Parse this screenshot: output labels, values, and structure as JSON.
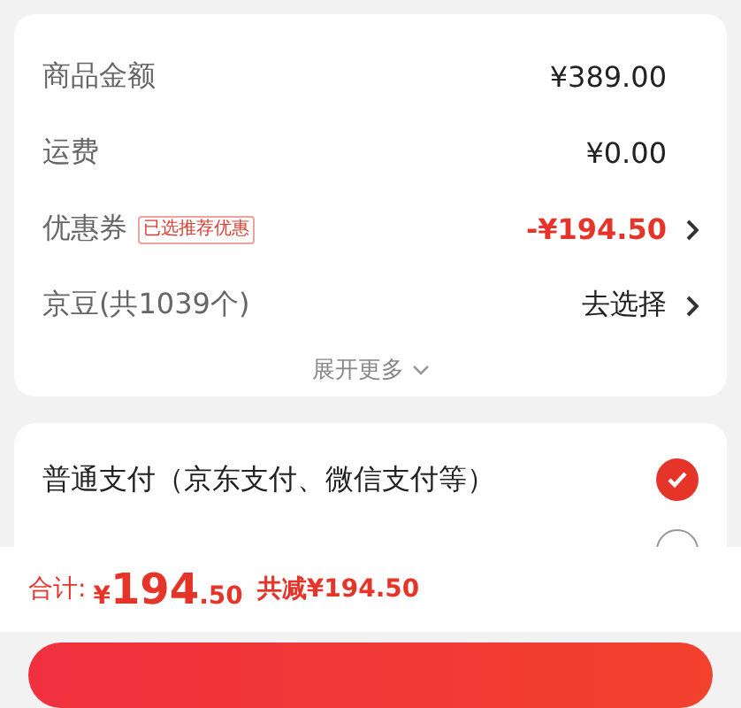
{
  "summary_rows": [
    {
      "kind": "plain",
      "label": "商品金额",
      "value": "¥389.00"
    },
    {
      "kind": "plain",
      "label": "运费",
      "value": "¥0.00"
    },
    {
      "kind": "discount",
      "label": "优惠券",
      "tag": "已选推荐优惠",
      "value": "-¥194.50"
    },
    {
      "kind": "link",
      "label": "京豆(共1039个)",
      "value": "去选择"
    }
  ],
  "expand": {
    "label": "展开更多"
  },
  "payment_options": [
    {
      "label": "普通支付（京东支付、微信支付等）",
      "selected": true
    },
    {
      "selected": false
    }
  ],
  "footer": {
    "total_label": "合计:",
    "currency": "¥",
    "total_integer": "194",
    "total_decimal": ".50",
    "saved": "共减¥194.50"
  }
}
